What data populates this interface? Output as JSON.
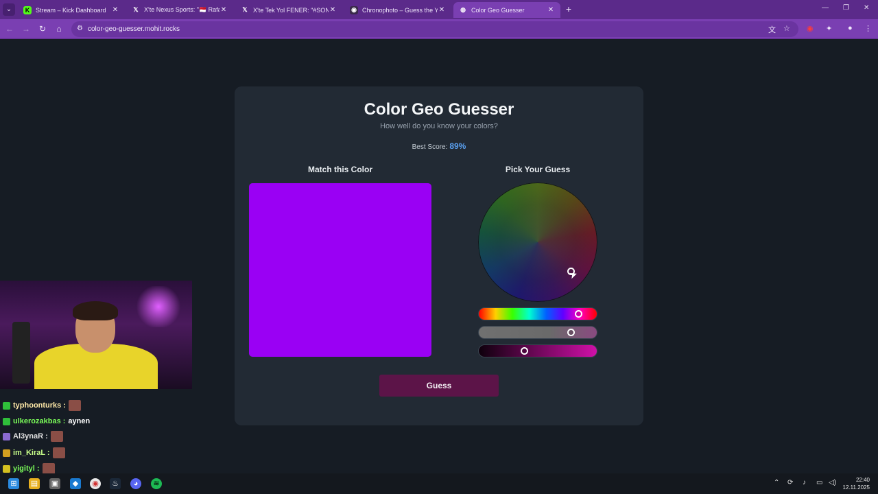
{
  "browser": {
    "tabs": [
      {
        "label": "Stream – Kick Dashboard",
        "icon": "kick-icon",
        "active": false
      },
      {
        "label": "X'te Nexus Sports: \"🇲🇨 Rafa Silva",
        "icon": "x-icon",
        "active": false
      },
      {
        "label": "X'te Tek Yol FENER: \"#SONDAKİ",
        "icon": "x-icon",
        "active": false
      },
      {
        "label": "Chronophoto – Guess the Year",
        "icon": "camera-icon",
        "active": false
      },
      {
        "label": "Color Geo Guesser",
        "icon": "globe-icon",
        "active": true
      }
    ],
    "new_tab": "+",
    "url": "color-geo-guesser.mohit.rocks"
  },
  "app": {
    "title": "Color Geo Guesser",
    "subtitle": "How well do you know your colors?",
    "best_score_label": "Best Score:",
    "best_score_value": "89%",
    "match_heading": "Match this Color",
    "pick_heading": "Pick Your Guess",
    "target_color": "#9a00f4",
    "sliders": {
      "hue": 0.84,
      "saturation": 0.78,
      "lightness": 0.39
    },
    "guess_button": "Guess"
  },
  "chat": [
    {
      "user": "typhoonturks :",
      "msg": "",
      "emote": true,
      "color": "#ffe9a8",
      "badge_color": "#2fbf3a"
    },
    {
      "user": "ulkerozakbas :",
      "msg": "aynen",
      "emote": false,
      "color": "#7cff5a",
      "badge_color": "#2fbf3a"
    },
    {
      "user": "Al3ynaR :",
      "msg": "",
      "emote": true,
      "color": "#e0e0e0",
      "badge_color": "#8a6ad0"
    },
    {
      "user": "im_KiraL :",
      "msg": "",
      "emote": true,
      "color": "#c8ff8a",
      "badge_color": "#d4a020"
    },
    {
      "user": "yigityl :",
      "msg": "",
      "emote": true,
      "color": "#7cff5a",
      "badge_color": "#d4c020"
    }
  ],
  "taskbar": {
    "time": "22:40",
    "date": "12.11.2025"
  }
}
